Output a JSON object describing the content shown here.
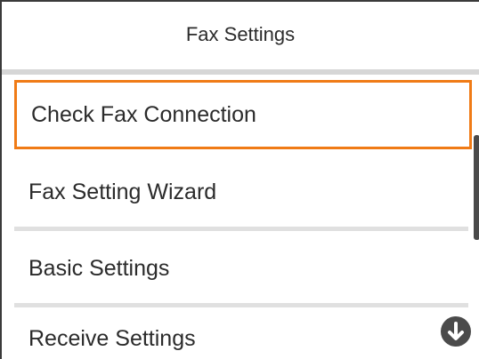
{
  "header": {
    "title": "Fax Settings"
  },
  "menu": {
    "items": [
      {
        "label": "Check Fax Connection",
        "selected": true
      },
      {
        "label": "Fax Setting Wizard",
        "selected": false
      },
      {
        "label": "Basic Settings",
        "selected": false
      },
      {
        "label": "Receive Settings",
        "selected": false
      }
    ]
  },
  "icons": {
    "scroll_down": "arrow-down-circle-icon"
  },
  "colors": {
    "selection_border": "#f07b16",
    "text": "#2b2b2b",
    "separator": "#e0e0e0"
  }
}
